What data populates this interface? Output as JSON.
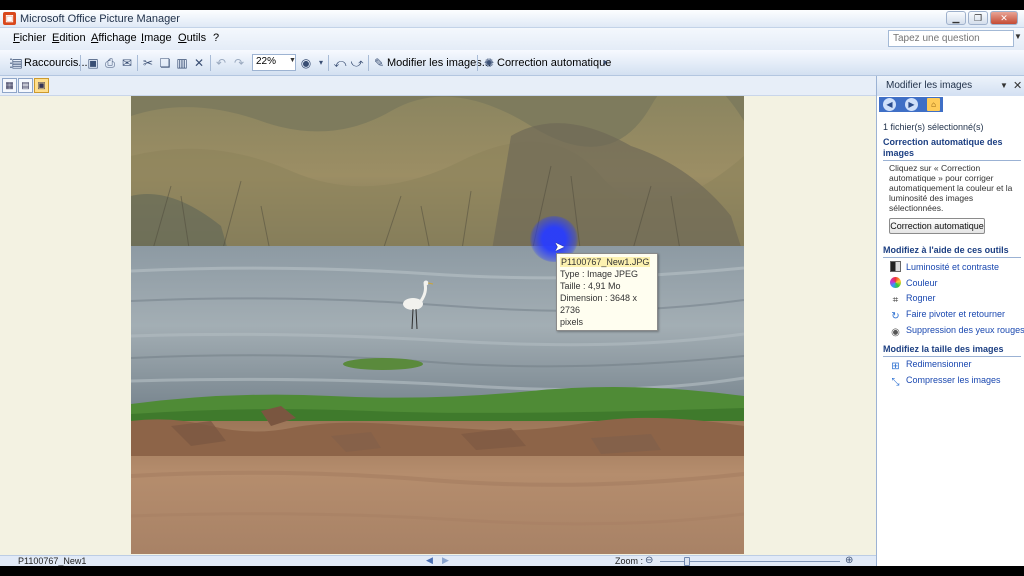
{
  "window": {
    "title": "Microsoft Office Picture Manager",
    "icon": "picture-manager-icon"
  },
  "menu": {
    "items": [
      "Fichier",
      "Edition",
      "Affichage",
      "Image",
      "Outils",
      "?"
    ],
    "help_placeholder": "Tapez une question"
  },
  "toolbar": {
    "shortcuts_label": "Raccourcis...",
    "zoom_value": "22%",
    "edit_images_label": "Modifier les images...",
    "auto_correct_label": "Correction automatique"
  },
  "tooltip": {
    "filename": "P1100767_New1.JPG",
    "type": "Type : Image JPEG",
    "size": "Taille : 4,91 Mo",
    "dimension": "Dimension : 3648 x 2736",
    "dimension_unit": "pixels"
  },
  "status": {
    "filename": "P1100767_New1",
    "zoom_label": "Zoom :",
    "zoom_slider_fraction": 0.15
  },
  "taskpane": {
    "title": "Modifier les images",
    "selected": "1 fichier(s) sélectionné(s)",
    "section_auto": "Correction automatique des images",
    "auto_desc": "Cliquez sur « Correction automatique » pour corriger automatiquement la couleur et la luminosité des images sélectionnées.",
    "auto_button": "Correction automatique",
    "section_tools": "Modifiez à l'aide de ces outils",
    "tools": [
      {
        "label": "Luminosité et contraste",
        "icon": "brightness-contrast-icon"
      },
      {
        "label": "Couleur",
        "icon": "color-icon"
      },
      {
        "label": "Rogner",
        "icon": "crop-icon"
      },
      {
        "label": "Faire pivoter et retourner",
        "icon": "rotate-flip-icon"
      },
      {
        "label": "Suppression des yeux rouges",
        "icon": "red-eye-icon"
      }
    ],
    "section_size": "Modifiez la taille des images",
    "size_tools": [
      {
        "label": "Redimensionner",
        "icon": "resize-icon"
      },
      {
        "label": "Compresser les images",
        "icon": "compress-icon"
      }
    ]
  }
}
